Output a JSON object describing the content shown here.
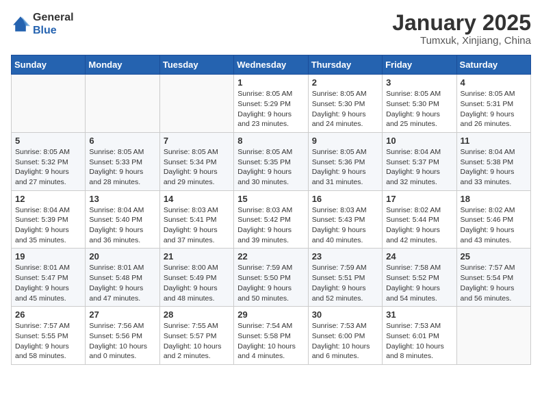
{
  "header": {
    "logo": {
      "general": "General",
      "blue": "Blue"
    },
    "title": "January 2025",
    "location": "Tumxuk, Xinjiang, China"
  },
  "weekdays": [
    "Sunday",
    "Monday",
    "Tuesday",
    "Wednesday",
    "Thursday",
    "Friday",
    "Saturday"
  ],
  "weeks": [
    [
      {
        "day": "",
        "info": ""
      },
      {
        "day": "",
        "info": ""
      },
      {
        "day": "",
        "info": ""
      },
      {
        "day": "1",
        "info": "Sunrise: 8:05 AM\nSunset: 5:29 PM\nDaylight: 9 hours\nand 23 minutes."
      },
      {
        "day": "2",
        "info": "Sunrise: 8:05 AM\nSunset: 5:30 PM\nDaylight: 9 hours\nand 24 minutes."
      },
      {
        "day": "3",
        "info": "Sunrise: 8:05 AM\nSunset: 5:30 PM\nDaylight: 9 hours\nand 25 minutes."
      },
      {
        "day": "4",
        "info": "Sunrise: 8:05 AM\nSunset: 5:31 PM\nDaylight: 9 hours\nand 26 minutes."
      }
    ],
    [
      {
        "day": "5",
        "info": "Sunrise: 8:05 AM\nSunset: 5:32 PM\nDaylight: 9 hours\nand 27 minutes."
      },
      {
        "day": "6",
        "info": "Sunrise: 8:05 AM\nSunset: 5:33 PM\nDaylight: 9 hours\nand 28 minutes."
      },
      {
        "day": "7",
        "info": "Sunrise: 8:05 AM\nSunset: 5:34 PM\nDaylight: 9 hours\nand 29 minutes."
      },
      {
        "day": "8",
        "info": "Sunrise: 8:05 AM\nSunset: 5:35 PM\nDaylight: 9 hours\nand 30 minutes."
      },
      {
        "day": "9",
        "info": "Sunrise: 8:05 AM\nSunset: 5:36 PM\nDaylight: 9 hours\nand 31 minutes."
      },
      {
        "day": "10",
        "info": "Sunrise: 8:04 AM\nSunset: 5:37 PM\nDaylight: 9 hours\nand 32 minutes."
      },
      {
        "day": "11",
        "info": "Sunrise: 8:04 AM\nSunset: 5:38 PM\nDaylight: 9 hours\nand 33 minutes."
      }
    ],
    [
      {
        "day": "12",
        "info": "Sunrise: 8:04 AM\nSunset: 5:39 PM\nDaylight: 9 hours\nand 35 minutes."
      },
      {
        "day": "13",
        "info": "Sunrise: 8:04 AM\nSunset: 5:40 PM\nDaylight: 9 hours\nand 36 minutes."
      },
      {
        "day": "14",
        "info": "Sunrise: 8:03 AM\nSunset: 5:41 PM\nDaylight: 9 hours\nand 37 minutes."
      },
      {
        "day": "15",
        "info": "Sunrise: 8:03 AM\nSunset: 5:42 PM\nDaylight: 9 hours\nand 39 minutes."
      },
      {
        "day": "16",
        "info": "Sunrise: 8:03 AM\nSunset: 5:43 PM\nDaylight: 9 hours\nand 40 minutes."
      },
      {
        "day": "17",
        "info": "Sunrise: 8:02 AM\nSunset: 5:44 PM\nDaylight: 9 hours\nand 42 minutes."
      },
      {
        "day": "18",
        "info": "Sunrise: 8:02 AM\nSunset: 5:46 PM\nDaylight: 9 hours\nand 43 minutes."
      }
    ],
    [
      {
        "day": "19",
        "info": "Sunrise: 8:01 AM\nSunset: 5:47 PM\nDaylight: 9 hours\nand 45 minutes."
      },
      {
        "day": "20",
        "info": "Sunrise: 8:01 AM\nSunset: 5:48 PM\nDaylight: 9 hours\nand 47 minutes."
      },
      {
        "day": "21",
        "info": "Sunrise: 8:00 AM\nSunset: 5:49 PM\nDaylight: 9 hours\nand 48 minutes."
      },
      {
        "day": "22",
        "info": "Sunrise: 7:59 AM\nSunset: 5:50 PM\nDaylight: 9 hours\nand 50 minutes."
      },
      {
        "day": "23",
        "info": "Sunrise: 7:59 AM\nSunset: 5:51 PM\nDaylight: 9 hours\nand 52 minutes."
      },
      {
        "day": "24",
        "info": "Sunrise: 7:58 AM\nSunset: 5:52 PM\nDaylight: 9 hours\nand 54 minutes."
      },
      {
        "day": "25",
        "info": "Sunrise: 7:57 AM\nSunset: 5:54 PM\nDaylight: 9 hours\nand 56 minutes."
      }
    ],
    [
      {
        "day": "26",
        "info": "Sunrise: 7:57 AM\nSunset: 5:55 PM\nDaylight: 9 hours\nand 58 minutes."
      },
      {
        "day": "27",
        "info": "Sunrise: 7:56 AM\nSunset: 5:56 PM\nDaylight: 10 hours\nand 0 minutes."
      },
      {
        "day": "28",
        "info": "Sunrise: 7:55 AM\nSunset: 5:57 PM\nDaylight: 10 hours\nand 2 minutes."
      },
      {
        "day": "29",
        "info": "Sunrise: 7:54 AM\nSunset: 5:58 PM\nDaylight: 10 hours\nand 4 minutes."
      },
      {
        "day": "30",
        "info": "Sunrise: 7:53 AM\nSunset: 6:00 PM\nDaylight: 10 hours\nand 6 minutes."
      },
      {
        "day": "31",
        "info": "Sunrise: 7:53 AM\nSunset: 6:01 PM\nDaylight: 10 hours\nand 8 minutes."
      },
      {
        "day": "",
        "info": ""
      }
    ]
  ]
}
